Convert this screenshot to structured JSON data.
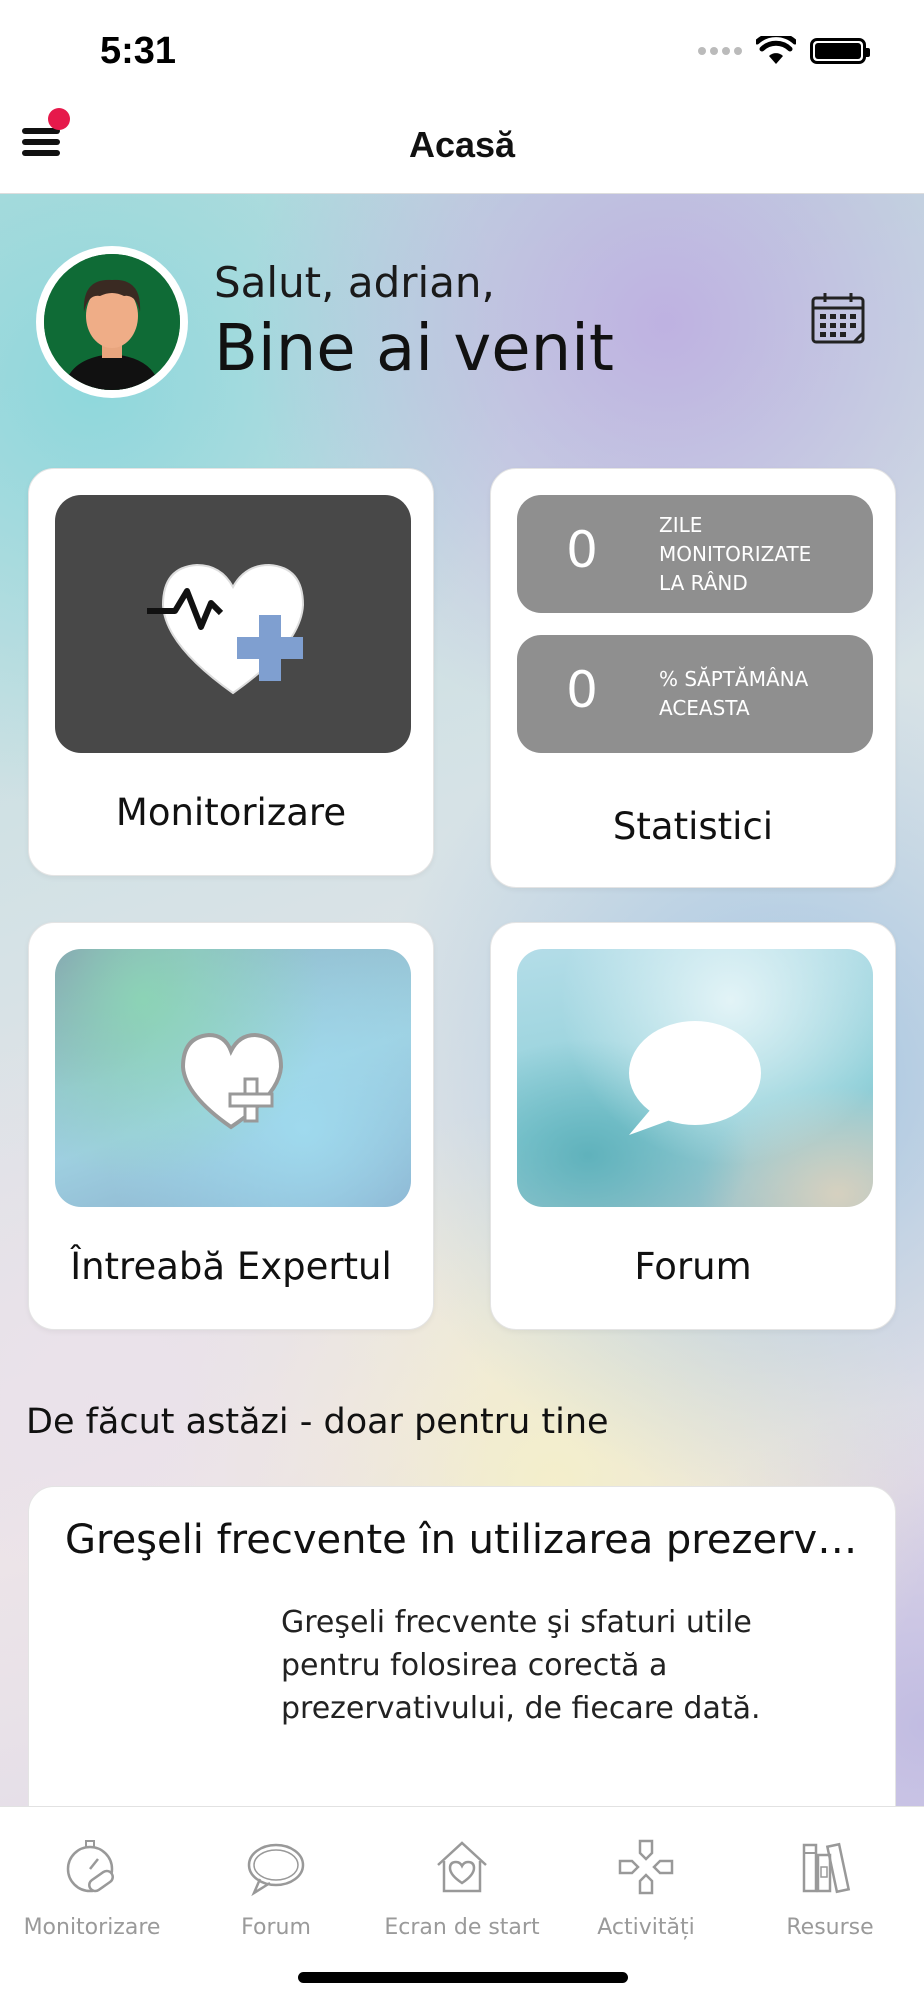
{
  "status_bar": {
    "time": "5:31"
  },
  "nav": {
    "title": "Acasă",
    "has_notification": true
  },
  "greeting": {
    "hello": "Salut, adrian,",
    "welcome": "Bine ai venit"
  },
  "cards": {
    "monitor": {
      "label": "Monitorizare"
    },
    "stats": {
      "label": "Statistici",
      "streak_value": "0",
      "streak_text": [
        "ZILE",
        "MONITORIZATE",
        "LA RÂND"
      ],
      "week_value": "0",
      "week_text": [
        "% SĂPTĂMÂNA",
        "ACEASTA"
      ]
    },
    "expert": {
      "label": "Întreabă Expertul"
    },
    "forum": {
      "label": "Forum"
    }
  },
  "todo": {
    "section_title": "De făcut astăzi - doar pentru tine",
    "article": {
      "title": "Greşeli frecvente în utilizarea prezervativului",
      "description": "Greşeli frecvente şi sfaturi utile pentru folosirea corectă a prezervativului, de fiecare dată."
    }
  },
  "tabs": [
    {
      "label": "Monitorizare",
      "icon": "stopwatch-pill-icon"
    },
    {
      "label": "Forum",
      "icon": "speech-bubble-icon"
    },
    {
      "label": "Ecran de start",
      "icon": "house-heart-icon"
    },
    {
      "label": "Activități",
      "icon": "gamepad-icon"
    },
    {
      "label": "Resurse",
      "icon": "books-icon"
    }
  ],
  "colors": {
    "notification_dot": "#e6194b",
    "monitor_tile": "#484848",
    "stat_pill": "#8f8f8f",
    "heart_plus": "#7f9fd0",
    "tab_inactive": "#9a9a9a"
  }
}
